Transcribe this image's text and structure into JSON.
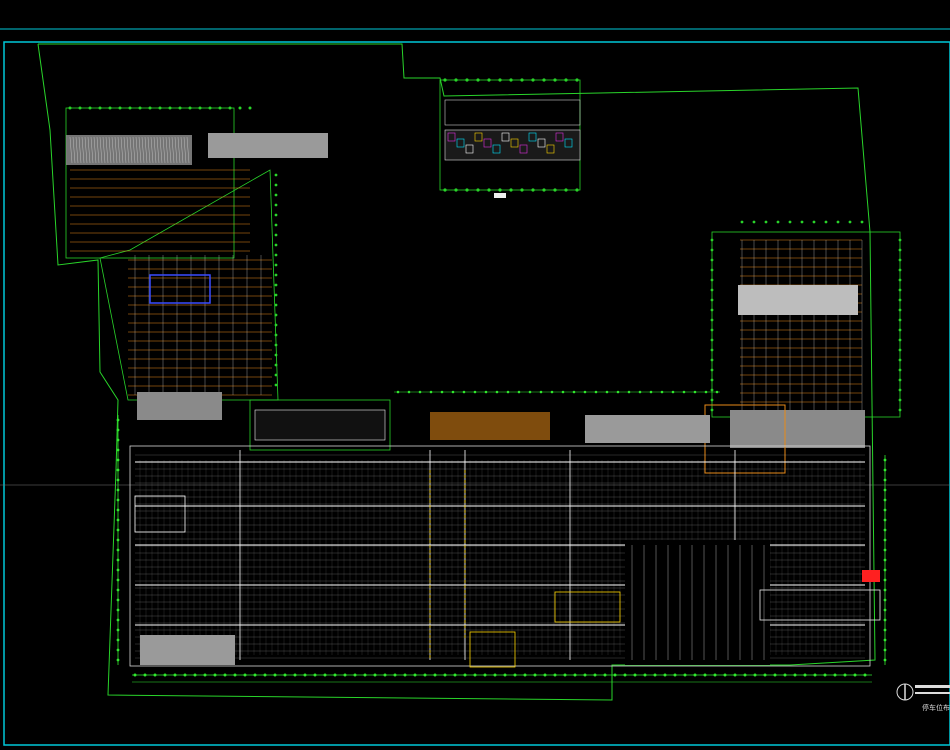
{
  "drawing": {
    "background": "#000000",
    "frame_color": "#00c8d8",
    "boundary_color": "#29d42a",
    "grid_color": "#d8d8d8",
    "dim_color": "#31e82f",
    "accent_orange": "#e88a17",
    "accent_yellow": "#ffd600",
    "accent_magenta": "#e030e0",
    "accent_blue": "#3a4cff",
    "accent_red": "#ff2020",
    "accent_cyan": "#00e5ff",
    "gray_fill": "#9a9a9a"
  },
  "title_block": {
    "text": "停车位布置"
  }
}
